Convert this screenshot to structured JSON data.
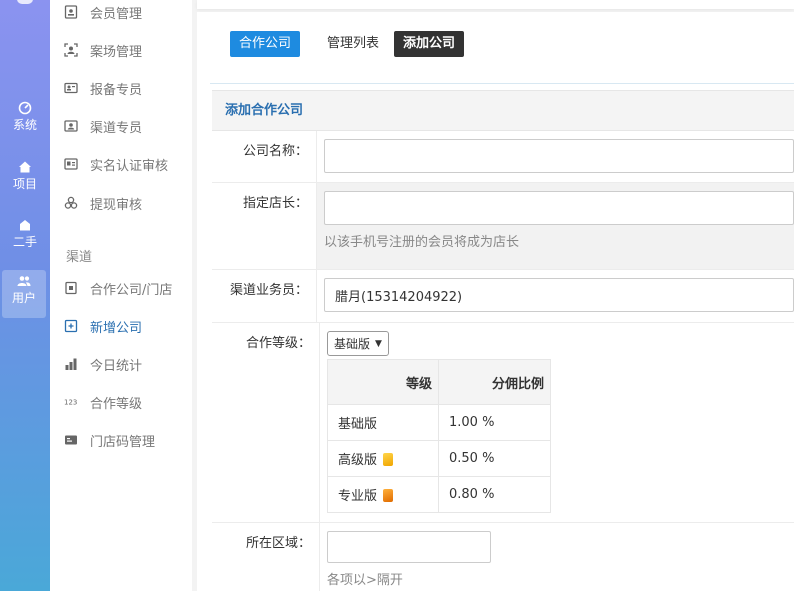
{
  "rail": {
    "items": [
      {
        "label": "系统",
        "icon": "dashboard-icon"
      },
      {
        "label": "项目",
        "icon": "home-icon"
      },
      {
        "label": "二手",
        "icon": "house-icon"
      },
      {
        "label": "用户",
        "icon": "users-icon",
        "active": true
      }
    ]
  },
  "submenu": {
    "items_top": [
      {
        "label": "会员管理",
        "icon": "member-card-icon"
      },
      {
        "label": "案场管理",
        "icon": "scan-user-icon"
      },
      {
        "label": "报备专员",
        "icon": "id-card-icon"
      },
      {
        "label": "渠道专员",
        "icon": "contact-card-icon"
      },
      {
        "label": "实名认证审核",
        "icon": "verify-card-icon"
      },
      {
        "label": "提现审核",
        "icon": "coins-icon"
      }
    ],
    "group_label": "渠道",
    "items_channel": [
      {
        "label": "合作公司/门店",
        "icon": "store-icon"
      },
      {
        "label": "新增公司",
        "icon": "add-box-icon",
        "active": true
      },
      {
        "label": "今日统计",
        "icon": "bar-chart-icon"
      },
      {
        "label": "合作等级",
        "icon": "number-123-icon"
      },
      {
        "label": "门店码管理",
        "icon": "qr-card-icon"
      }
    ]
  },
  "tabs": {
    "company": "合作公司",
    "list": "管理列表",
    "add": "添加公司"
  },
  "form": {
    "title": "添加合作公司",
    "company_name_label": "公司名称：",
    "company_name_value": "",
    "manager_label": "指定店长：",
    "manager_value": "",
    "manager_hint": "以该手机号注册的会员将成为店长",
    "agent_label": "渠道业务员：",
    "agent_value": "腊月(15314204922)",
    "level_label": "合作等级：",
    "level_selected": "基础版",
    "level_table": {
      "headers": [
        "等级",
        "分佣比例"
      ],
      "rows": [
        {
          "level": "基础版",
          "ratio": "1.00 %"
        },
        {
          "level": "高级版",
          "ratio": "0.50 %"
        },
        {
          "level": "专业版",
          "ratio": "0.80 %"
        }
      ]
    },
    "region_label": "所在区域：",
    "region_value": "",
    "region_hint": "各项以>隔开"
  },
  "colors": {
    "accent": "#1e8be0",
    "dark_tab": "#333333",
    "link": "#2a6fb0"
  }
}
